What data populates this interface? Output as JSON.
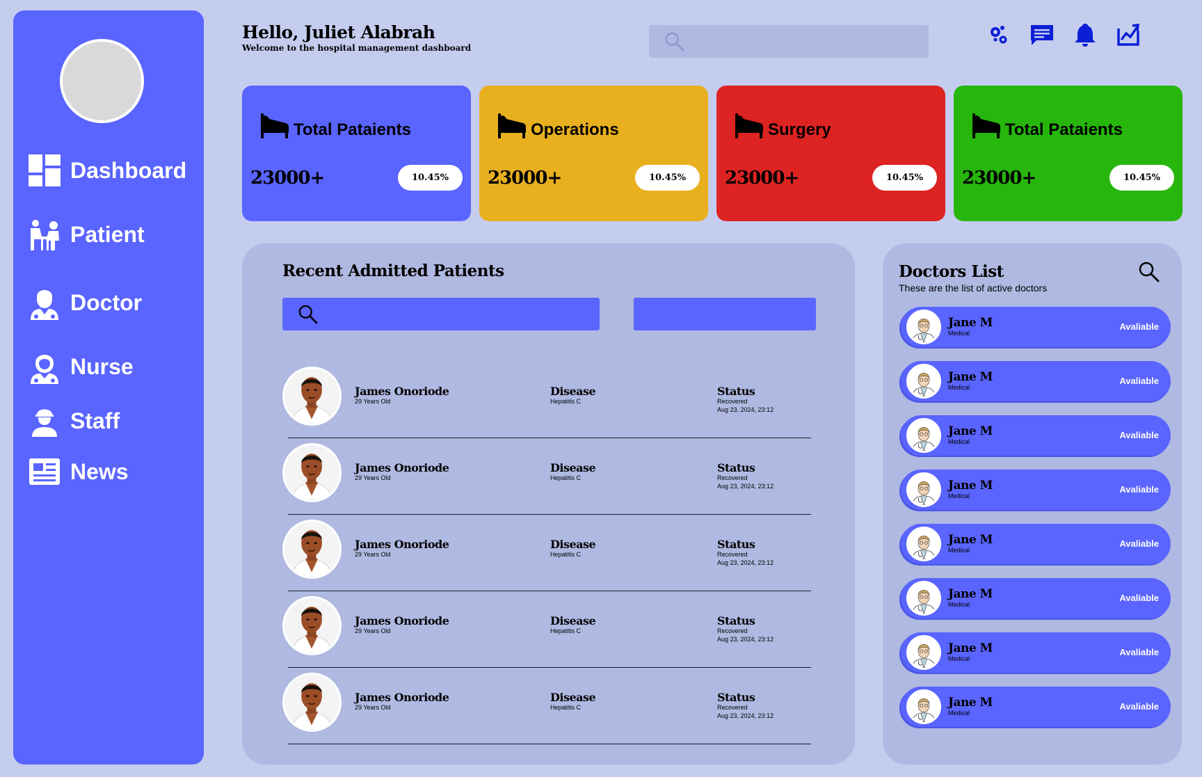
{
  "colors": {
    "page_bg": "#c5cdef",
    "sidebar": "#5a64fe",
    "panel": "#afb9e1",
    "blue": "#5a64fe",
    "yellow": "#e8b01e",
    "red": "#de2323",
    "green": "#27b60c",
    "icon_dark_blue": "#0c1fd6"
  },
  "header": {
    "greeting": "Hello, Juliet Alabrah",
    "subtitle": "Welcome to the hospital management dashboard",
    "search_placeholder": "",
    "icons": [
      "settings-icon",
      "messages-icon",
      "bell-icon",
      "analytics-icon"
    ]
  },
  "sidebar": {
    "items": [
      {
        "label": "Dashboard",
        "icon": "dashboard-icon"
      },
      {
        "label": "Patient",
        "icon": "patient-icon"
      },
      {
        "label": "Doctor",
        "icon": "doctor-icon"
      },
      {
        "label": "Nurse",
        "icon": "nurse-icon"
      },
      {
        "label": "Staff",
        "icon": "staff-icon"
      },
      {
        "label": "News",
        "icon": "news-icon"
      }
    ]
  },
  "stats": [
    {
      "label": "Total Pataients",
      "value": "23000+",
      "change": "10.45%",
      "color": "#5a64fe",
      "icon": "hospital-bed-icon"
    },
    {
      "label": "Operations",
      "value": "23000+",
      "change": "10.45%",
      "color": "#e8b01e",
      "icon": "hospital-bed-icon"
    },
    {
      "label": "Surgery",
      "value": "23000+",
      "change": "10.45%",
      "color": "#de2323",
      "icon": "hospital-bed-icon"
    },
    {
      "label": "Total Pataients",
      "value": "23000+",
      "change": "10.45%",
      "color": "#27b60c",
      "icon": "hospital-bed-icon"
    }
  ],
  "recent": {
    "title": "Recent Admitted Patients",
    "search_placeholder": "",
    "patients": [
      {
        "name": "James Onoriode",
        "age": "29 Years Old",
        "disease_label": "Disease",
        "disease": "Hepatitis C",
        "status_label": "Status",
        "status": "Recovered",
        "date": "Aug 23, 2024, 23:12"
      },
      {
        "name": "James Onoriode",
        "age": "29 Years Old",
        "disease_label": "Disease",
        "disease": "Hepatitis C",
        "status_label": "Status",
        "status": "Recovered",
        "date": "Aug 23, 2024, 23:12"
      },
      {
        "name": "James Onoriode",
        "age": "29 Years Old",
        "disease_label": "Disease",
        "disease": "Hepatitis C",
        "status_label": "Status",
        "status": "Recovered",
        "date": "Aug 23, 2024, 23:12"
      },
      {
        "name": "James Onoriode",
        "age": "29 Years Old",
        "disease_label": "Disease",
        "disease": "Hepatitis C",
        "status_label": "Status",
        "status": "Recovered",
        "date": "Aug 23, 2024, 23:12"
      },
      {
        "name": "James Onoriode",
        "age": "29 Years Old",
        "disease_label": "Disease",
        "disease": "Hepatitis C",
        "status_label": "Status",
        "status": "Recovered",
        "date": "Aug 23, 2024, 23:12"
      }
    ]
  },
  "doctors": {
    "title": "Doctors List",
    "subtitle": "These are the list of active doctors",
    "list": [
      {
        "name": "Jane M",
        "specialty": "Medical",
        "status": "Avaliable"
      },
      {
        "name": "Jane M",
        "specialty": "Medical",
        "status": "Avaliable"
      },
      {
        "name": "Jane M",
        "specialty": "Medical",
        "status": "Avaliable"
      },
      {
        "name": "Jane M",
        "specialty": "Medical",
        "status": "Avaliable"
      },
      {
        "name": "Jane M",
        "specialty": "Medical",
        "status": "Avaliable"
      },
      {
        "name": "Jane M",
        "specialty": "Medical",
        "status": "Avaliable"
      },
      {
        "name": "Jane M",
        "specialty": "Medical",
        "status": "Avaliable"
      },
      {
        "name": "Jane M",
        "specialty": "Medical",
        "status": "Avaliable"
      }
    ]
  }
}
